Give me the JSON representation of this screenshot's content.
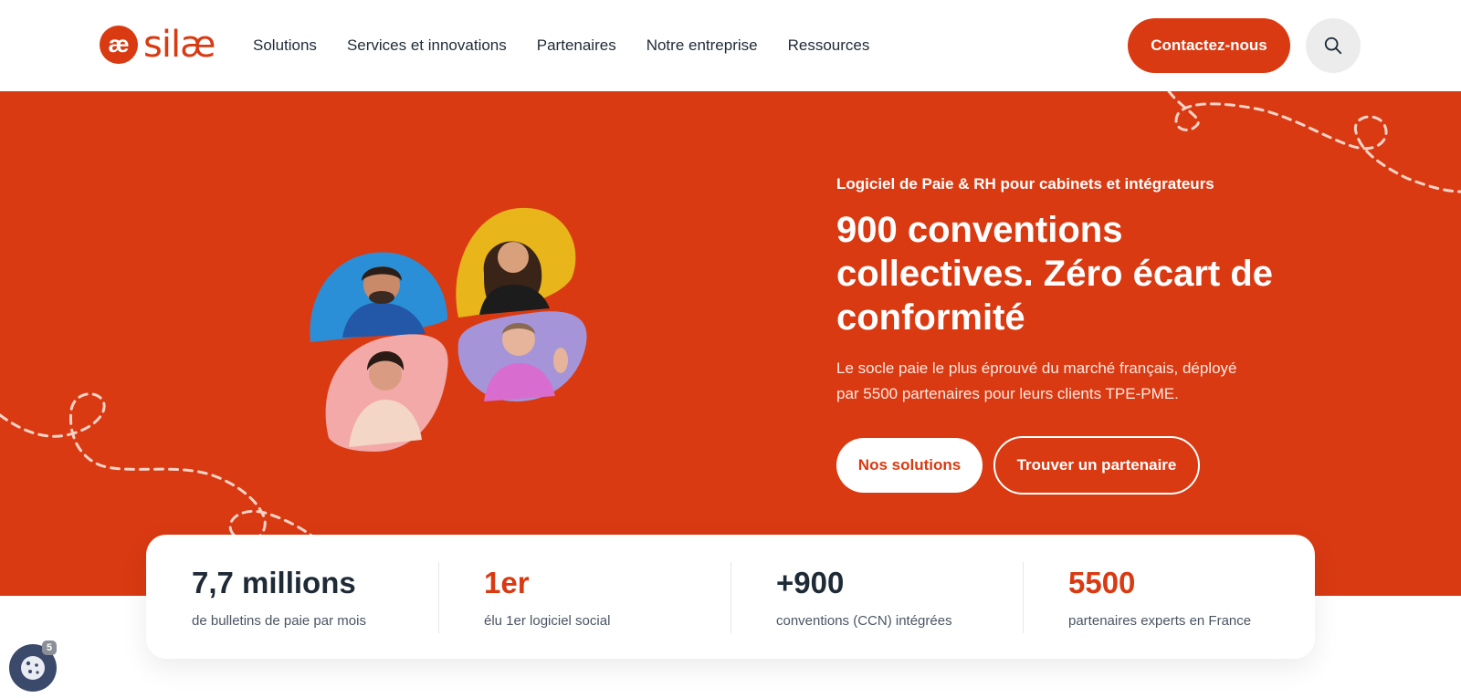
{
  "header": {
    "logo_mark": "æ",
    "logo_text": "silæ",
    "nav": [
      "Solutions",
      "Services et innovations",
      "Partenaires",
      "Notre entreprise",
      "Ressources"
    ],
    "contact_label": "Contactez-nous",
    "search_icon": "search-icon"
  },
  "hero": {
    "tagline": "Logiciel de Paie & RH pour cabinets et intégrateurs",
    "title": "900 conventions collectives. Zéro écart de conformité",
    "subtitle": "Le socle paie le plus éprouvé du marché français, déployé par 5500 partenaires pour leurs clients TPE-PME.",
    "primary_cta": "Nos solutions",
    "secondary_cta": "Trouver un partenaire"
  },
  "stats": [
    {
      "value": "7,7 millions",
      "label": "de bulletins de paie par mois",
      "accent": false
    },
    {
      "value": "1er",
      "label": "élu 1er logiciel social",
      "accent": true
    },
    {
      "value": "+900",
      "label": "conventions (CCN) intégrées",
      "accent": false
    },
    {
      "value": "5500",
      "label": "partenaires experts en France",
      "accent": true
    }
  ],
  "cookie": {
    "icon": "cookie-icon",
    "badge": "5"
  },
  "colors": {
    "brand": "#d93a12",
    "text_dark": "#1f2a37",
    "photo_blue": "#2a8fd6",
    "photo_yellow": "#e8b61a",
    "photo_pink": "#f2a9a8",
    "photo_lavender": "#a594d8"
  }
}
